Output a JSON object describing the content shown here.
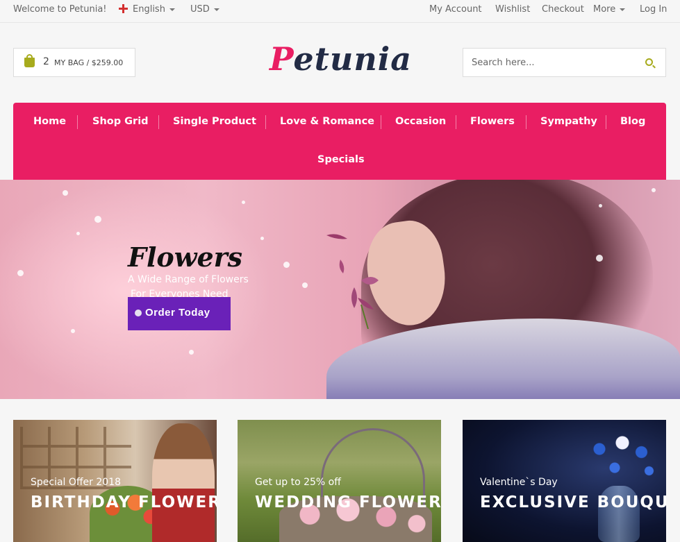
{
  "topbar": {
    "welcome": "Welcome to Petunia!",
    "language": "English",
    "currency": "USD",
    "links": [
      "My Account",
      "Wishlist",
      "Checkout",
      "More",
      "Log In"
    ]
  },
  "header": {
    "cart_count": "2",
    "cart_label": "MY BAG / $259.00",
    "logo_first": "P",
    "logo_rest": "etunia",
    "search_placeholder": "Search here..."
  },
  "nav": {
    "items": [
      "Home",
      "Shop Grid",
      "Single Product",
      "Love & Romance",
      "Occasion",
      "Flowers",
      "Sympathy",
      "Blog",
      "Specials"
    ]
  },
  "hero": {
    "title": "Flowers",
    "subtitle_line1": "A Wide Range of Flowers",
    "subtitle_line2": "For Everyones Need",
    "button": "Order Today"
  },
  "cards": [
    {
      "small": "Special Offer 2018",
      "big": "BIRTHDAY FLOWERS"
    },
    {
      "small": "Get up to 25% off",
      "big": "WEDDING FLOWERS"
    },
    {
      "small": "Valentine`s Day",
      "big": "EXCLUSIVE BOUQUET"
    }
  ],
  "colors": {
    "accent": "#e91e63",
    "button": "#6a21b8",
    "icon_olive": "#a7ab1d",
    "logo_dark": "#222b45"
  }
}
